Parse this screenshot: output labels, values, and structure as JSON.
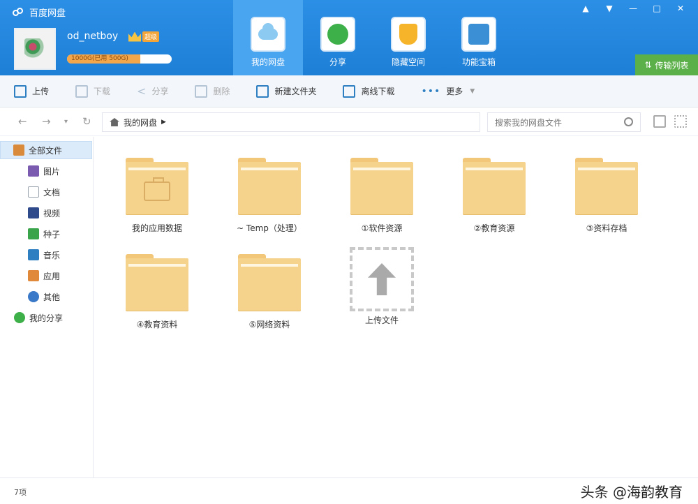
{
  "app": {
    "title": "百度网盘",
    "window_controls": [
      "▲",
      "▼",
      "—",
      "□",
      "✕"
    ]
  },
  "user": {
    "name": "od_netboy",
    "vip_tag": "超级",
    "quota_text": "1000G(已用 500G)",
    "quota_fraction": 0.7
  },
  "nav_tabs": [
    {
      "label": "我的网盘",
      "icon": "cloud-icon",
      "active": true
    },
    {
      "label": "分享",
      "icon": "share-icon",
      "active": false
    },
    {
      "label": "隐藏空间",
      "icon": "lock-icon",
      "active": false
    },
    {
      "label": "功能宝箱",
      "icon": "toolbox-icon",
      "active": false
    }
  ],
  "sync_button": {
    "label": "传输列表"
  },
  "toolbar": {
    "upload": "上传",
    "download": "下载",
    "share": "分享",
    "delete": "删除",
    "new_folder": "新建文件夹",
    "offline_download": "离线下载",
    "more": "更多"
  },
  "addressbar": {
    "path": "我的网盘",
    "search_placeholder": "搜索我的网盘文件"
  },
  "sidebar": {
    "items": [
      {
        "label": "全部文件",
        "icon": "folder-icon",
        "color": "#d98a3a"
      },
      {
        "label": "图片",
        "icon": "image-icon",
        "color": "#7a5bb0"
      },
      {
        "label": "文档",
        "icon": "document-icon",
        "color": "#9aa4ae"
      },
      {
        "label": "视频",
        "icon": "video-icon",
        "color": "#2f4a8a"
      },
      {
        "label": "种子",
        "icon": "bt-icon",
        "color": "#3aa44a"
      },
      {
        "label": "音乐",
        "icon": "music-icon",
        "color": "#2e7fc2"
      },
      {
        "label": "应用",
        "icon": "app-icon",
        "color": "#e0893a"
      },
      {
        "label": "其他",
        "icon": "other-icon",
        "color": "#3a78c8"
      },
      {
        "label": "我的分享",
        "icon": "share-icon",
        "color": "#3eb04a"
      }
    ]
  },
  "files": [
    {
      "label": "我的应用数据",
      "type": "app-folder"
    },
    {
      "label": "~ Temp（处理）",
      "type": "folder"
    },
    {
      "label": "①软件资源",
      "type": "folder"
    },
    {
      "label": "②教育资源",
      "type": "folder"
    },
    {
      "label": "③资料存档",
      "type": "folder"
    },
    {
      "label": "④教育资料",
      "type": "folder"
    },
    {
      "label": "⑤网络资料",
      "type": "folder"
    },
    {
      "label": "上传文件",
      "type": "upload"
    }
  ],
  "status": {
    "count": "7项"
  },
  "watermark": "头条 @海韵教育"
}
